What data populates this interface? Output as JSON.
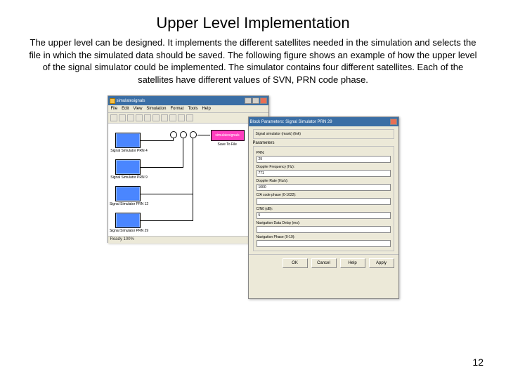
{
  "title": "Upper Level Implementation",
  "body": "The upper level can be designed. It implements the different satellites needed in the simulation and selects the file in which the simulated data should be saved. The following figure shows an example of how the upper level of the signal simulator could be implemented. The simulator contains four different satellites. Each of the satellites have different values of SVN, PRN code phase.",
  "page_number": "12",
  "sim_window": {
    "title": "simulatesignals",
    "menus": [
      "File",
      "Edit",
      "View",
      "Simulation",
      "Format",
      "Tools",
      "Help"
    ],
    "blocks": {
      "b1": "Signal Simulator PRN 4",
      "b2": "Signal Simulator PRN 9",
      "b3": "Signal Simulator PRN 12",
      "b4": "Signal Simulator PRN 29"
    },
    "sink": "simulatesignals",
    "sink_label": "Save To File",
    "status": "Ready  100%"
  },
  "dialog": {
    "title": "Block Parameters: Signal Simulator PRN 29",
    "desc": "Signal simulator (mask) (link)",
    "section": "Parameters",
    "params_label": "PRN:",
    "fields": {
      "prn": "29",
      "doppler_label": "Doppler Frequency (Hz):",
      "doppler": "771",
      "doppler_rate_label": "Doppler Rate (Hz/s):",
      "doppler_rate": "1000",
      "code_label": "C/A code phase (0-1022):",
      "code": "",
      "cn0_label": "C/N0 (dB):",
      "cn0": "5",
      "delay_label": "Navigation Data Delay (ms):",
      "delay": "",
      "phase_label": "Navigation Phase (0-19):",
      "phase": ""
    },
    "buttons": {
      "ok": "OK",
      "cancel": "Cancel",
      "help": "Help",
      "apply": "Apply"
    }
  }
}
